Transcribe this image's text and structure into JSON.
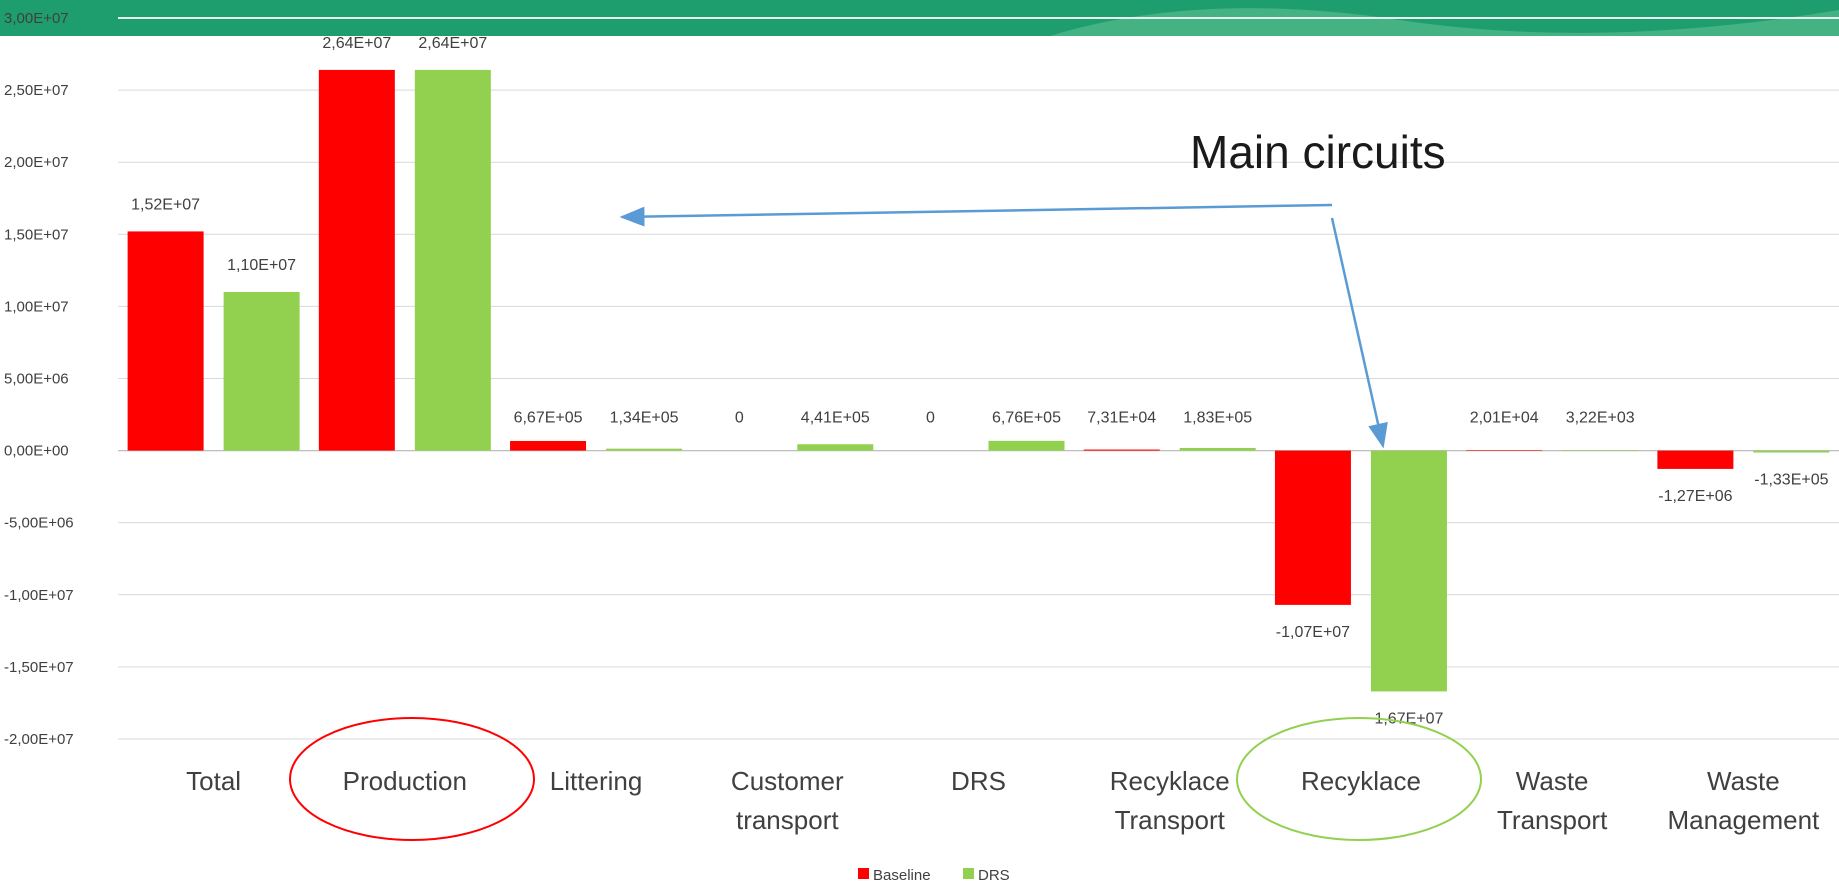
{
  "chart_data": {
    "type": "bar",
    "categories": [
      [
        "Total"
      ],
      [
        "Production"
      ],
      [
        "Littering"
      ],
      [
        "Customer",
        "transport"
      ],
      [
        "DRS"
      ],
      [
        "Recyklace",
        "Transport"
      ],
      [
        "Recyklace"
      ],
      [
        "Waste",
        "Transport"
      ],
      [
        "Waste",
        "Management"
      ]
    ],
    "series": [
      {
        "name": "Baseline",
        "color": "#ff0000",
        "values": [
          15200000,
          26400000,
          667000,
          0,
          0,
          73100,
          -10700000,
          20100,
          -1270000
        ],
        "labels": [
          "1,52E+07",
          "2,64E+07",
          "6,67E+05",
          "0",
          "0",
          "7,31E+04",
          "-1,07E+07",
          "2,01E+04",
          "-1,27E+06"
        ]
      },
      {
        "name": "DRS",
        "color": "#92d050",
        "values": [
          11000000,
          26400000,
          134000,
          441000,
          676000,
          183000,
          -16700000,
          3220,
          -133000
        ],
        "labels": [
          "1,10E+07",
          "2,64E+07",
          "1,34E+05",
          "4,41E+05",
          "6,76E+05",
          "1,83E+05",
          "1,67E+07",
          "3,22E+03",
          "-1,33E+05"
        ]
      }
    ],
    "y_ticks": [
      "-2,00E+07",
      "-1,50E+07",
      "-1,00E+07",
      "-5,00E+06",
      "0,00E+00",
      "5,00E+06",
      "1,00E+07",
      "1,50E+07",
      "2,00E+07",
      "2,50E+07",
      "3,00E+07"
    ],
    "ylim": [
      -20000000,
      30000000
    ],
    "grid": true,
    "legend": "bottom",
    "annotation": "Main circuits",
    "highlighted_categories": [
      {
        "category": "Production",
        "color": "#ff0000"
      },
      {
        "category": "Recyklace",
        "color": "#92d050"
      }
    ],
    "header_band_color": "#1e9e6e",
    "arrow_color": "#5b9bd5"
  }
}
